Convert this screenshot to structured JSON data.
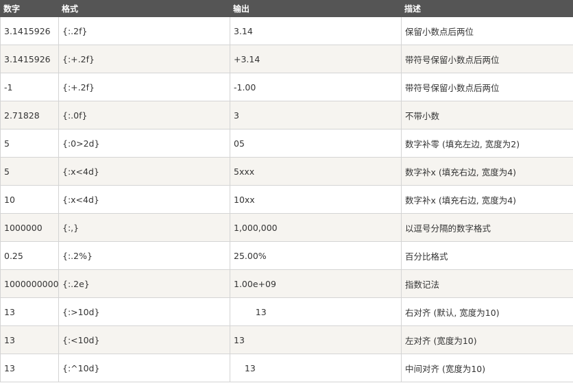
{
  "table": {
    "headers": [
      "数字",
      "格式",
      "输出",
      "描述"
    ],
    "rows": [
      [
        "3.1415926",
        "{:.2f}",
        "3.14",
        "保留小数点后两位"
      ],
      [
        "3.1415926",
        "{:+.2f}",
        "+3.14",
        "带符号保留小数点后两位"
      ],
      [
        "-1",
        "{:+.2f}",
        "-1.00",
        "带符号保留小数点后两位"
      ],
      [
        "2.71828",
        "{:.0f}",
        "3",
        "不带小数"
      ],
      [
        "5",
        "{:0>2d}",
        "05",
        "数字补零 (填充左边, 宽度为2)"
      ],
      [
        "5",
        "{:x<4d}",
        "5xxx",
        "数字补x (填充右边, 宽度为4)"
      ],
      [
        "10",
        "{:x<4d}",
        "10xx",
        "数字补x (填充右边, 宽度为4)"
      ],
      [
        "1000000",
        "{:,}",
        "1,000,000",
        "以逗号分隔的数字格式"
      ],
      [
        "0.25",
        "{:.2%}",
        "25.00%",
        "百分比格式"
      ],
      [
        "1000000000",
        "{:.2e}",
        "1.00e+09",
        "指数记法"
      ],
      [
        "13",
        "{:>10d}",
        "        13",
        "右对齐 (默认, 宽度为10)"
      ],
      [
        "13",
        "{:<10d}",
        "13",
        "左对齐 (宽度为10)"
      ],
      [
        "13",
        "{:^10d}",
        "    13",
        "中间对齐 (宽度为10)"
      ]
    ]
  }
}
